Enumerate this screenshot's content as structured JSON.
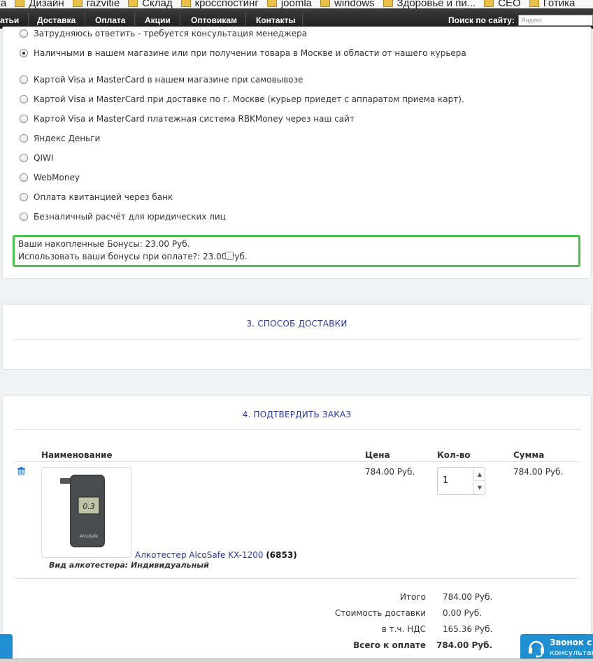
{
  "bookmarks": [
    "ка",
    "Дизайн",
    "razvitie",
    "Склад",
    "кросспостинг",
    "joomla",
    "windows",
    "Здоровье и пи...",
    "CEO",
    "Готика"
  ],
  "nav": {
    "items": [
      "атьи",
      "Доставка",
      "Оплата",
      "Акции",
      "Оптовикам",
      "Контакты"
    ],
    "search_label": "Поиск по сайту:",
    "search_placeholder": "Яндекс"
  },
  "payment": {
    "options": [
      {
        "label": "Затрудняюсь ответить - требуется консультация менеджера",
        "checked": false
      },
      {
        "label": "Наличными в нашем магазине или при получении товара в Москве и области от нашего курьера",
        "checked": true
      },
      {
        "label": "Картой Visa и MasterCard в нашем магазине при самовывозе",
        "checked": false
      },
      {
        "label": "Картой Visa и MasterCard при доставке по г. Москве (курьер приедет с аппаратом приема карт).",
        "checked": false
      },
      {
        "label": "Картой Visa и MasterCard платежная система RBKMoney через наш сайт",
        "checked": false
      },
      {
        "label": "Яндекс Деньги",
        "checked": false
      },
      {
        "label": "QIWI",
        "checked": false
      },
      {
        "label": "WebMoney",
        "checked": false
      },
      {
        "label": "Оплата квитанцией через банк",
        "checked": false
      },
      {
        "label": "Безналичный расчёт для юридических лиц",
        "checked": false
      }
    ],
    "bonus": {
      "accumulated": "Ваши накопленные Бонусы: 23.00 Руб.",
      "use_label": "Использовать ваши бонусы при оплате?: 23.00 Руб."
    }
  },
  "delivery": {
    "title": "3. СПОСОБ ДОСТАВКИ"
  },
  "confirm": {
    "title": "4. ПОДТВЕРДИТЬ ЗАКАЗ",
    "columns": {
      "name": "Наименование",
      "price": "Цена",
      "qty": "Кол-во",
      "sum": "Сумма"
    },
    "item": {
      "name": "Алкотестер AlcoSafe KX-1200",
      "code": "(6853)",
      "option": "Вид алкотестера: Индивидуальный",
      "price": "784.00 Руб.",
      "qty": "1",
      "sum": "784.00 Руб.",
      "display_reading": "0.3",
      "brand": "AlcoSafe"
    },
    "totals": [
      {
        "label": "Итого",
        "value": "784.00 Руб.",
        "bold": false
      },
      {
        "label": "Стоимость доставки",
        "value": "0.00 Руб.",
        "bold": false
      },
      {
        "label": "в т.ч. НДС",
        "value": "165.36 Руб.",
        "bold": false
      },
      {
        "label": "Всего к оплате",
        "value": "784.00 Руб.",
        "bold": true
      }
    ]
  },
  "callback": {
    "title": "Звонок с",
    "subtitle": "консультан"
  },
  "colors": {
    "accent_green": "#4cc04c",
    "link_blue": "#2b3a9a",
    "widget_blue": "#1f8fd2"
  }
}
